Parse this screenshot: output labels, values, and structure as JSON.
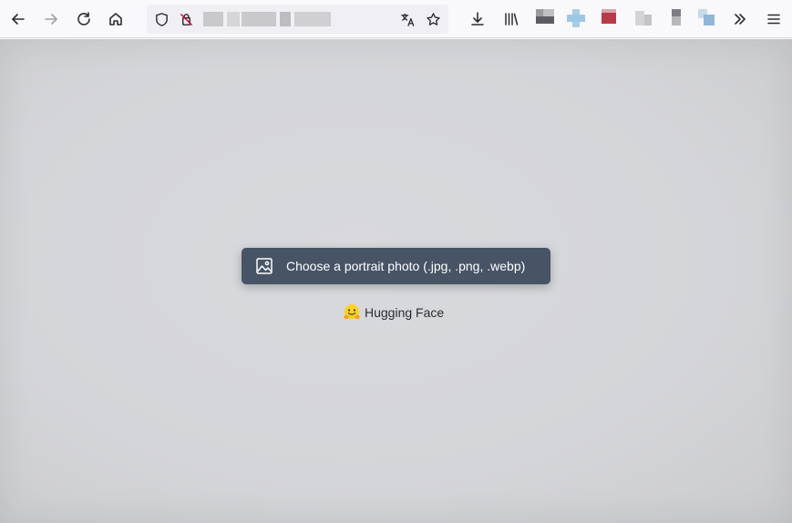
{
  "browser": {
    "url": "",
    "icons": {
      "back": "arrow-left-icon",
      "forward": "arrow-right-icon",
      "reload": "reload-icon",
      "home": "home-icon",
      "tracking_protection": "shield-icon",
      "permissions": "person-slash-icon",
      "translate": "translate-icon",
      "bookmark_star": "star-icon",
      "downloads": "download-icon",
      "library": "library-icon",
      "overflow": "chevron-double-right-icon",
      "menu": "hamburger-menu-icon"
    },
    "bookmark_favicons": [
      "#5c5c63",
      "#9cc6e8",
      "#b83a48",
      "#c8c8cc",
      "#9d9da3",
      "#8fb7d9"
    ]
  },
  "page": {
    "upload_label": "Choose a portrait photo (.jpg, .png, .webp)",
    "upload_icon": "image-icon",
    "credit_label": "Hugging Face",
    "credit_icon": "hugging-face-emoji-icon",
    "colors": {
      "button_bg": "#475466",
      "button_text": "#ffffff",
      "page_bg": "#d5d6d9"
    }
  }
}
